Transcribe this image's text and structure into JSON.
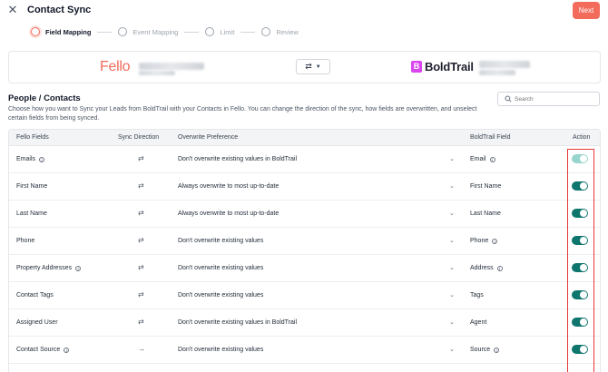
{
  "header": {
    "title": "Contact Sync",
    "close_icon": "close-icon",
    "next_label": "Next"
  },
  "stepper": {
    "steps": [
      {
        "label": "Field Mapping",
        "active": true
      },
      {
        "label": "Event Mapping",
        "active": false
      },
      {
        "label": "Limit",
        "active": false
      },
      {
        "label": "Review",
        "active": false
      }
    ]
  },
  "brands": {
    "left_name": "Fello",
    "right_mark": "B",
    "right_name": "BoldTrail",
    "swap_icon": "swap-arrows-icon"
  },
  "section": {
    "title": "People / Contacts",
    "description": "Choose how you want to Sync your Leads from BoldTrail with your Contacts in Fello. You can change the direction of the sync, how fields are overwritten, and unselect certain fields from being synced.",
    "search_placeholder": "Search"
  },
  "table": {
    "headers": {
      "fello": "Fello Fields",
      "direction": "Sync Direction",
      "preference": "Overwrite Preference",
      "boldtrail": "BoldTrail Field",
      "action": "Action"
    },
    "rows": [
      {
        "fello": "Emails",
        "fello_info": true,
        "direction": "⇄",
        "preference": "Don't overwrite existing values in BoldTrail",
        "boldtrail": "Email",
        "bt_info": true,
        "enabled": true,
        "disabled": true
      },
      {
        "fello": "First Name",
        "fello_info": false,
        "direction": "⇄",
        "preference": "Always overwrite to most up-to-date",
        "boldtrail": "First Name",
        "bt_info": false,
        "enabled": true,
        "disabled": false
      },
      {
        "fello": "Last Name",
        "fello_info": false,
        "direction": "⇄",
        "preference": "Always overwrite to most up-to-date",
        "boldtrail": "Last Name",
        "bt_info": false,
        "enabled": true,
        "disabled": false
      },
      {
        "fello": "Phone",
        "fello_info": false,
        "direction": "⇄",
        "preference": "Don't overwrite existing values",
        "boldtrail": "Phone",
        "bt_info": true,
        "enabled": true,
        "disabled": false
      },
      {
        "fello": "Property Addresses",
        "fello_info": true,
        "direction": "⇄",
        "preference": "Don't overwrite existing values",
        "boldtrail": "Address",
        "bt_info": true,
        "enabled": true,
        "disabled": false
      },
      {
        "fello": "Contact Tags",
        "fello_info": false,
        "direction": "⇄",
        "preference": "Don't overwrite existing values",
        "boldtrail": "Tags",
        "bt_info": false,
        "enabled": true,
        "disabled": false
      },
      {
        "fello": "Assigned User",
        "fello_info": false,
        "direction": "⇄",
        "preference": "Don't overwrite existing values in BoldTrail",
        "boldtrail": "Agent",
        "bt_info": false,
        "enabled": true,
        "disabled": false
      },
      {
        "fello": "Contact Source",
        "fello_info": true,
        "direction": "→",
        "preference": "Don't overwrite existing values",
        "boldtrail": "Source",
        "bt_info": true,
        "enabled": true,
        "disabled": false
      }
    ]
  },
  "colors": {
    "accent": "#f26b5b",
    "toggle_on": "#0f766e",
    "highlight": "#e53935"
  }
}
